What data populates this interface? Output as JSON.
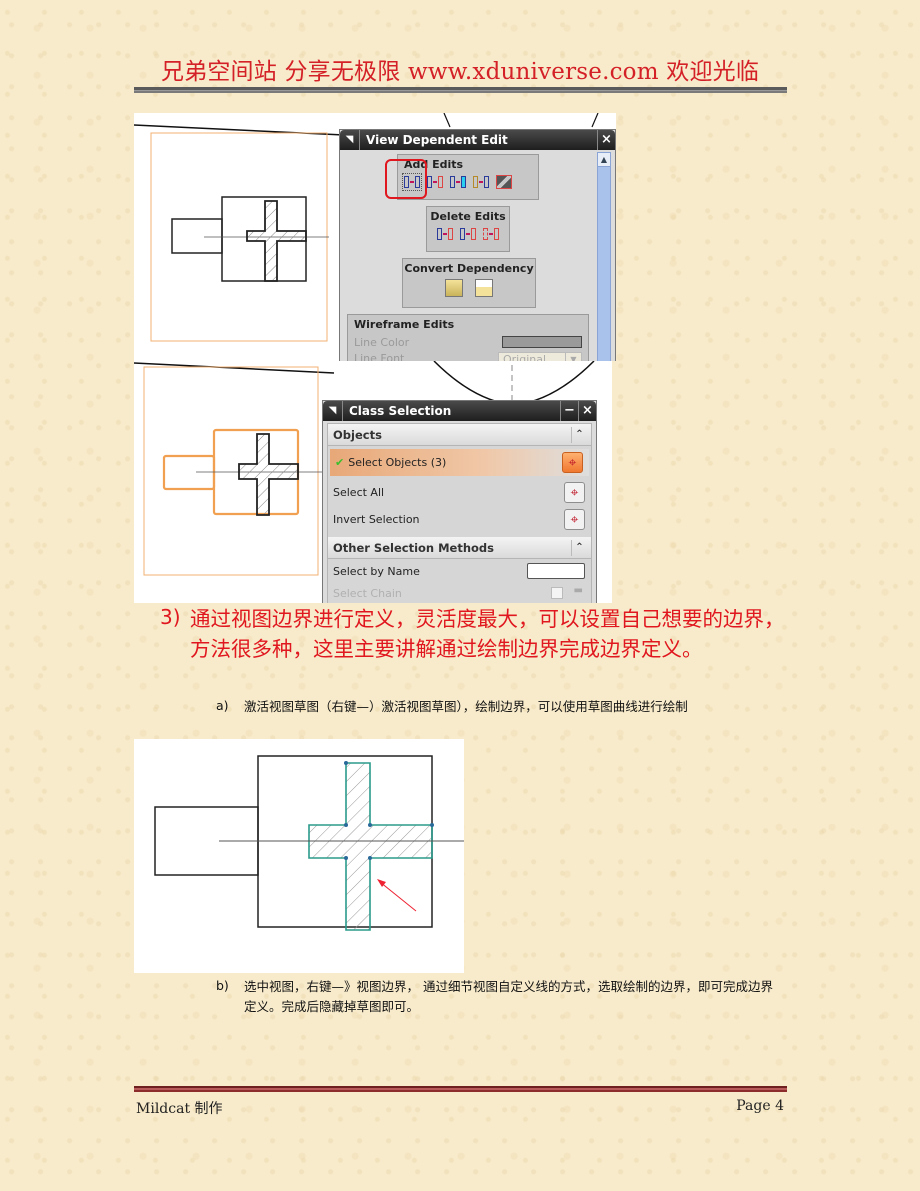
{
  "header": {
    "title": "兄弟空间站 分享无极限 www.xduniverse.com 欢迎光临"
  },
  "dialog_view_dependent_edit": {
    "title": "View Dependent Edit",
    "close_icon": "×",
    "add_edits": {
      "label": "Add Edits",
      "icons": [
        "add-selected-edit-icon",
        "add-edit-2-icon",
        "add-edit-3-icon",
        "add-edit-4-icon",
        "edit-entire-view-icon"
      ],
      "highlighted_index": 0
    },
    "delete_edits": {
      "label": "Delete Edits",
      "icons": [
        "delete-selected-erasures-icon",
        "delete-selected-modifications-icon",
        "delete-all-modifications-icon"
      ]
    },
    "convert_dependency": {
      "label": "Convert Dependency",
      "icons": [
        "model-to-view-icon",
        "view-to-model-icon"
      ]
    },
    "wireframe_edits": {
      "label": "Wireframe Edits",
      "line_color_label": "Line Color",
      "line_font_label": "Line Font",
      "line_font_value": "Original"
    }
  },
  "dialog_class_selection": {
    "title": "Class Selection",
    "minimize_icon": "−",
    "close_icon": "×",
    "objects_section": "Objects",
    "select_objects_label": "Select Objects (3)",
    "select_all_label": "Select All",
    "invert_selection_label": "Invert Selection",
    "other_methods_section": "Other Selection Methods",
    "select_by_name_label": "Select by Name",
    "select_by_name_value": "",
    "select_chain_label": "Select Chain"
  },
  "body": {
    "item3_number": "3)",
    "item3_text": "通过视图边界进行定义，灵活度最大，可以设置自己想要的边界，方法很多种，这里主要讲解通过绘制边界完成边界定义。",
    "sub_a_marker": "a)",
    "sub_a_text": "激活视图草图（右键—）激活视图草图），绘制边界，可以使用草图曲线进行绘制",
    "sub_b_marker": "b)",
    "sub_b_text": "选中视图，右键—》视图边界， 通过细节视图自定义线的方式，选取绘制的边界，即可完成边界定义。完成后隐藏掉草图即可。"
  },
  "footer": {
    "left": "Mildcat 制作",
    "right": "Page 4"
  },
  "colors": {
    "heading_red": "#e0171f",
    "header_red": "#d42027",
    "selection_orange": "#f0a050",
    "sketch_teal": "#2a9a8a"
  }
}
